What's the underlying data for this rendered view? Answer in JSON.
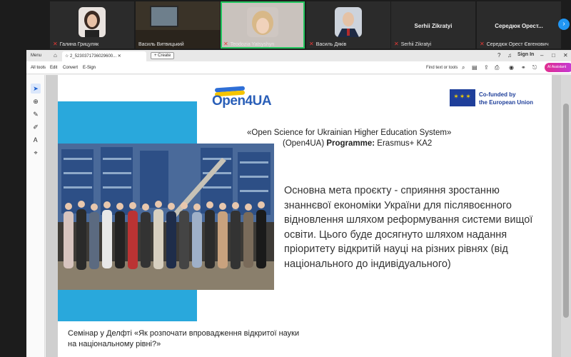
{
  "participants": [
    {
      "name": "Галина Грицуляк",
      "muted": true
    },
    {
      "name": "Василь Витвицький",
      "muted": false
    },
    {
      "name": "Teodozia Yatsyshyn",
      "muted": true,
      "active": true
    },
    {
      "name": "Василь Дяків",
      "muted": true
    },
    {
      "name": "Serhii Zikratyi",
      "muted": true,
      "label": "Serhii Zikratyi"
    },
    {
      "name": "Середюк Орест Євгенович",
      "muted": true,
      "label": "Середюк  Орест..."
    }
  ],
  "viewer": {
    "menu_label": "Menu",
    "doc_tab": "2_5230371736029600...",
    "create_label": "+ Create",
    "signin_label": "Sign In",
    "toolbar": {
      "all_tools": "All tools",
      "edit": "Edit",
      "convert": "Convert",
      "esign": "E-Sign",
      "find": "Find text or tools",
      "ai_button": "AI Assistant"
    }
  },
  "slide": {
    "logo_text": "Open4UA",
    "eu_caption_1": "Co-funded by",
    "eu_caption_2": "the European Union",
    "title_line1": "«Open Science for Ukrainian Higher Education System»",
    "title_line2_prefix": "(Open4UA) ",
    "title_line2_bold": "Programme:",
    "title_line2_suffix": " Erasmus+ KA2",
    "goal_text": "Основна мета проєкту - сприяння зростанню знаннєвої економіки України для післявоєнного відновлення шляхом реформування системи вищої освіти. Цього буде досягнуто шляхом надання пріоритету відкритій науці на різних рівнях (від національного до індивідуального)",
    "seminar_line1": "Семінар у Делфті «Як розпочати впровадження відкритої науки",
    "seminar_line2": "на національному рівні?»"
  },
  "colors": {
    "accent_cyan": "#29a8dc",
    "logo_blue": "#2a5fb8",
    "logo_yellow": "#f5c400",
    "eu_blue": "#1f3f9a",
    "active_speaker": "#22c55e"
  }
}
